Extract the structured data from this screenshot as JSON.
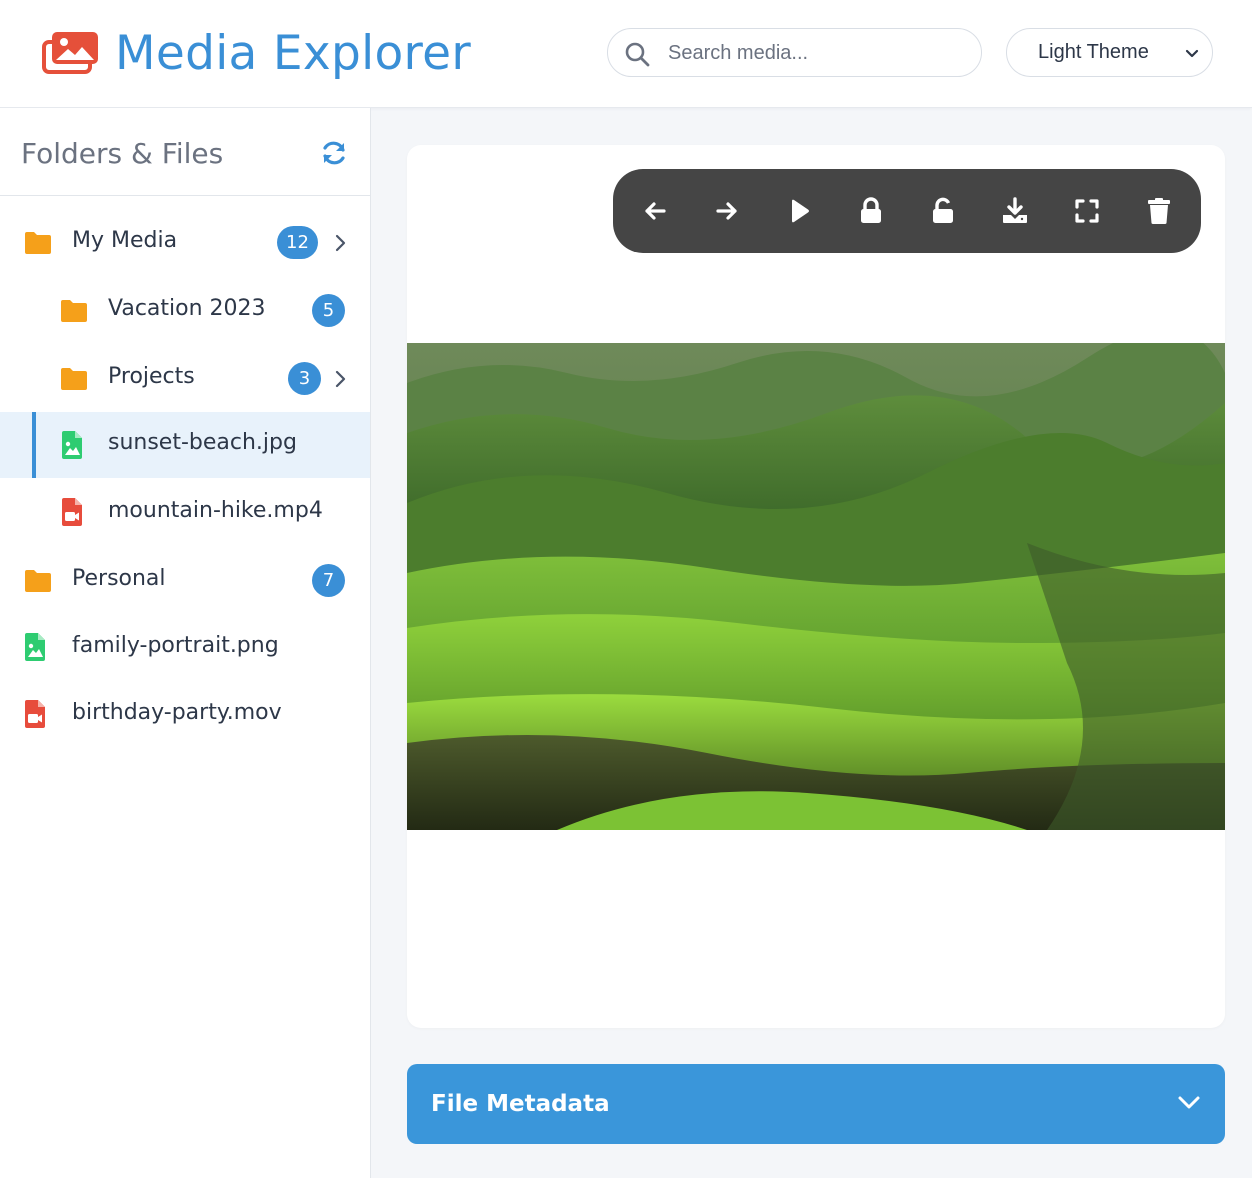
{
  "app": {
    "title": "Media Explorer"
  },
  "search": {
    "placeholder": "Search media..."
  },
  "theme": {
    "selected": "Light Theme"
  },
  "sidebar": {
    "title": "Folders & Files",
    "items": [
      {
        "type": "folder",
        "label": "My Media",
        "count": "12",
        "expandable": true
      },
      {
        "type": "folder",
        "label": "Vacation 2023",
        "count": "5",
        "expandable": false
      },
      {
        "type": "folder",
        "label": "Projects",
        "count": "3",
        "expandable": true
      },
      {
        "type": "image",
        "label": "sunset-beach.jpg",
        "active": true
      },
      {
        "type": "video",
        "label": "mountain-hike.mp4"
      },
      {
        "type": "folder",
        "label": "Personal",
        "count": "7",
        "expandable": false
      },
      {
        "type": "image",
        "label": "family-portrait.png"
      },
      {
        "type": "video",
        "label": "birthday-party.mov"
      }
    ]
  },
  "toolbar": {
    "buttons": [
      "arrow-left-icon",
      "arrow-right-icon",
      "play-icon",
      "lock-icon",
      "unlock-icon",
      "download-icon",
      "fullscreen-icon",
      "trash-icon"
    ]
  },
  "metadata": {
    "title": "File Metadata"
  },
  "colors": {
    "accent": "#3a8fd6",
    "folder": "#f5a01a",
    "image_file": "#2ecc71",
    "video_file": "#e74c3c",
    "toolbar_bg": "#454545"
  }
}
